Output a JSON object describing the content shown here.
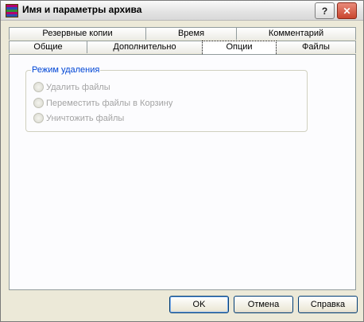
{
  "window": {
    "title": "Имя и параметры архива",
    "help_glyph": "?",
    "close_glyph": "✕",
    "app_icon": "winrar-archive-icon"
  },
  "tabs": {
    "row_back": [
      {
        "label": "Резервные копии"
      },
      {
        "label": "Время"
      },
      {
        "label": "Комментарий"
      }
    ],
    "row_front": [
      {
        "label": "Общие"
      },
      {
        "label": "Дополнительно"
      },
      {
        "label": "Опции",
        "active": true
      },
      {
        "label": "Файлы"
      }
    ]
  },
  "delete_mode": {
    "group_title": "Режим удаления",
    "options": [
      {
        "label": "Удалить файлы",
        "enabled": false
      },
      {
        "label": "Переместить файлы в Корзину",
        "enabled": false
      },
      {
        "label": "Уничтожить файлы",
        "enabled": false
      }
    ]
  },
  "buttons": {
    "ok": "OK",
    "cancel": "Отмена",
    "help": "Справка"
  },
  "colors": {
    "accent": "#0046d5",
    "disabled_text": "#a3a3a3",
    "dialog_bg": "#ece9d8"
  }
}
